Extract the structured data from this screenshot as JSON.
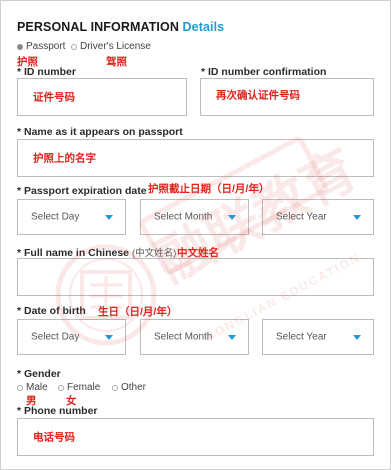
{
  "section": {
    "title": "PERSONAL INFORMATION",
    "title_accent": "Details"
  },
  "doc_type": {
    "options": [
      {
        "label": "Passport",
        "selected": true
      },
      {
        "label": "Driver's License",
        "selected": false
      }
    ],
    "annotations": [
      "护照",
      "驾照"
    ]
  },
  "id_number": {
    "label": "* ID number",
    "annotation": "证件号码"
  },
  "id_confirm": {
    "label": "* ID number confirmation",
    "annotation": "再次确认证件号码"
  },
  "passport_name": {
    "label": "* Name as it appears on passport",
    "annotation": "护照上的名字"
  },
  "expiration": {
    "label": "* Passport expiration date",
    "annotation": "护照截止日期（日/月/年）",
    "selects": [
      "Select Day",
      "Select Month",
      "Select Year"
    ]
  },
  "chinese_name": {
    "label": "* Full name in Chinese",
    "label_extra": "(中文姓名)",
    "annotation": "中文姓名"
  },
  "dob": {
    "label": "* Date of birth",
    "annotation": "生日（日/月/年）",
    "selects": [
      "Select Day",
      "Select Month",
      "Select Year"
    ]
  },
  "gender": {
    "label": "* Gender",
    "options": [
      {
        "label": "Male",
        "selected": false
      },
      {
        "label": "Female",
        "selected": false
      },
      {
        "label": "Other",
        "selected": false
      }
    ],
    "annotations": [
      "男",
      "女"
    ]
  },
  "phone": {
    "label": "* Phone number",
    "annotation": "电话号码"
  },
  "watermark": {
    "text": "融联教育",
    "sub": "RONGLIAN EDUCATION"
  },
  "colors": {
    "accent": "#1d9bd6",
    "annotation_red": "#e0231c",
    "border": "#bdbdbd"
  }
}
